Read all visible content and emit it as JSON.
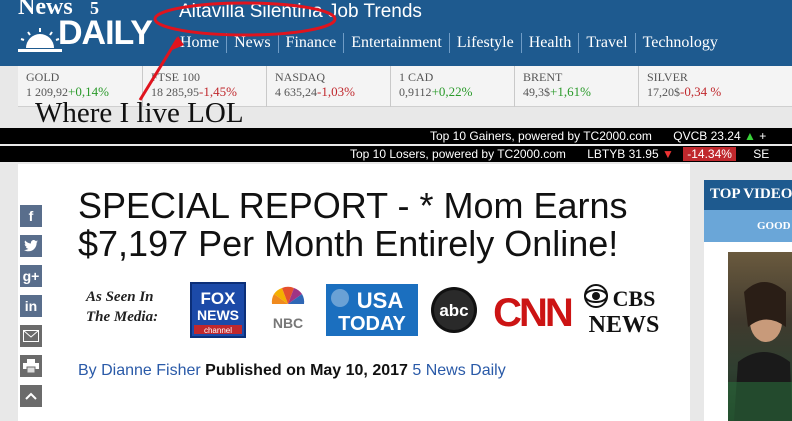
{
  "brand": {
    "news": "News",
    "five": "5",
    "daily": "DAILY"
  },
  "header": {
    "trend_title": "Altavilla Silentina Job Trends"
  },
  "nav": [
    "Home",
    "News",
    "Finance",
    "Entertainment",
    "Lifestyle",
    "Health",
    "Travel",
    "Technology"
  ],
  "markets": [
    {
      "name": "GOLD",
      "value": "1 209,92",
      "change": "+0,14%",
      "dir": "up"
    },
    {
      "name": "FTSE 100",
      "value": "18 285,95",
      "change": "-1,45%",
      "dir": "down"
    },
    {
      "name": "NASDAQ",
      "value": "4 635,24",
      "change": "-1,03%",
      "dir": "down"
    },
    {
      "name": "1 CAD",
      "value": "0,9112",
      "change": "+0,22%",
      "dir": "up"
    },
    {
      "name": "BRENT",
      "value": "49,3$",
      "change": "+1,61%",
      "dir": "up"
    },
    {
      "name": "SILVER",
      "value": "17,20$",
      "change": "-0,34 %",
      "dir": "down"
    }
  ],
  "annotation": "Where I live LOL",
  "tickers": {
    "gainers": {
      "label": "Top 10 Gainers, powered by TC2000.com",
      "symbol": "QVCB",
      "price": "23.24",
      "arrow": "▲",
      "tail": "+"
    },
    "losers": {
      "label": "Top 10 Losers, powered by TC2000.com",
      "symbol": "LBTYB",
      "price": "31.95",
      "arrow": "▼",
      "change": "-14.34%",
      "tail": "SE"
    }
  },
  "article": {
    "headline": "SPECIAL REPORT - * Mom Earns $7,197 Per Month Entirely Online!",
    "seen_line1": "As Seen In",
    "seen_line2": "The Media:",
    "byline_author": "By Dianne Fisher",
    "byline_published": "Published on May 10, 2017",
    "byline_source": "5 News Daily"
  },
  "media_logos": {
    "fox1": "FOX",
    "fox2": "NEWS",
    "fox3": "channel",
    "nbc": "NBC",
    "usa1": "USA",
    "usa2": "TODAY",
    "abc": "abc",
    "cnn": "CNN",
    "cbs1": "CBS",
    "cbs2": "NEWS"
  },
  "social": {
    "facebook": "f",
    "twitter": "t",
    "google": "g+",
    "linkedin": "in"
  },
  "sidebar": {
    "title": "TOP VIDEOS",
    "subtitle": "GOOD"
  },
  "colors": {
    "brand_blue": "#1e5a8f",
    "up": "#2a9a2a",
    "down": "#c0282d",
    "annotation_red": "#e0141e"
  }
}
